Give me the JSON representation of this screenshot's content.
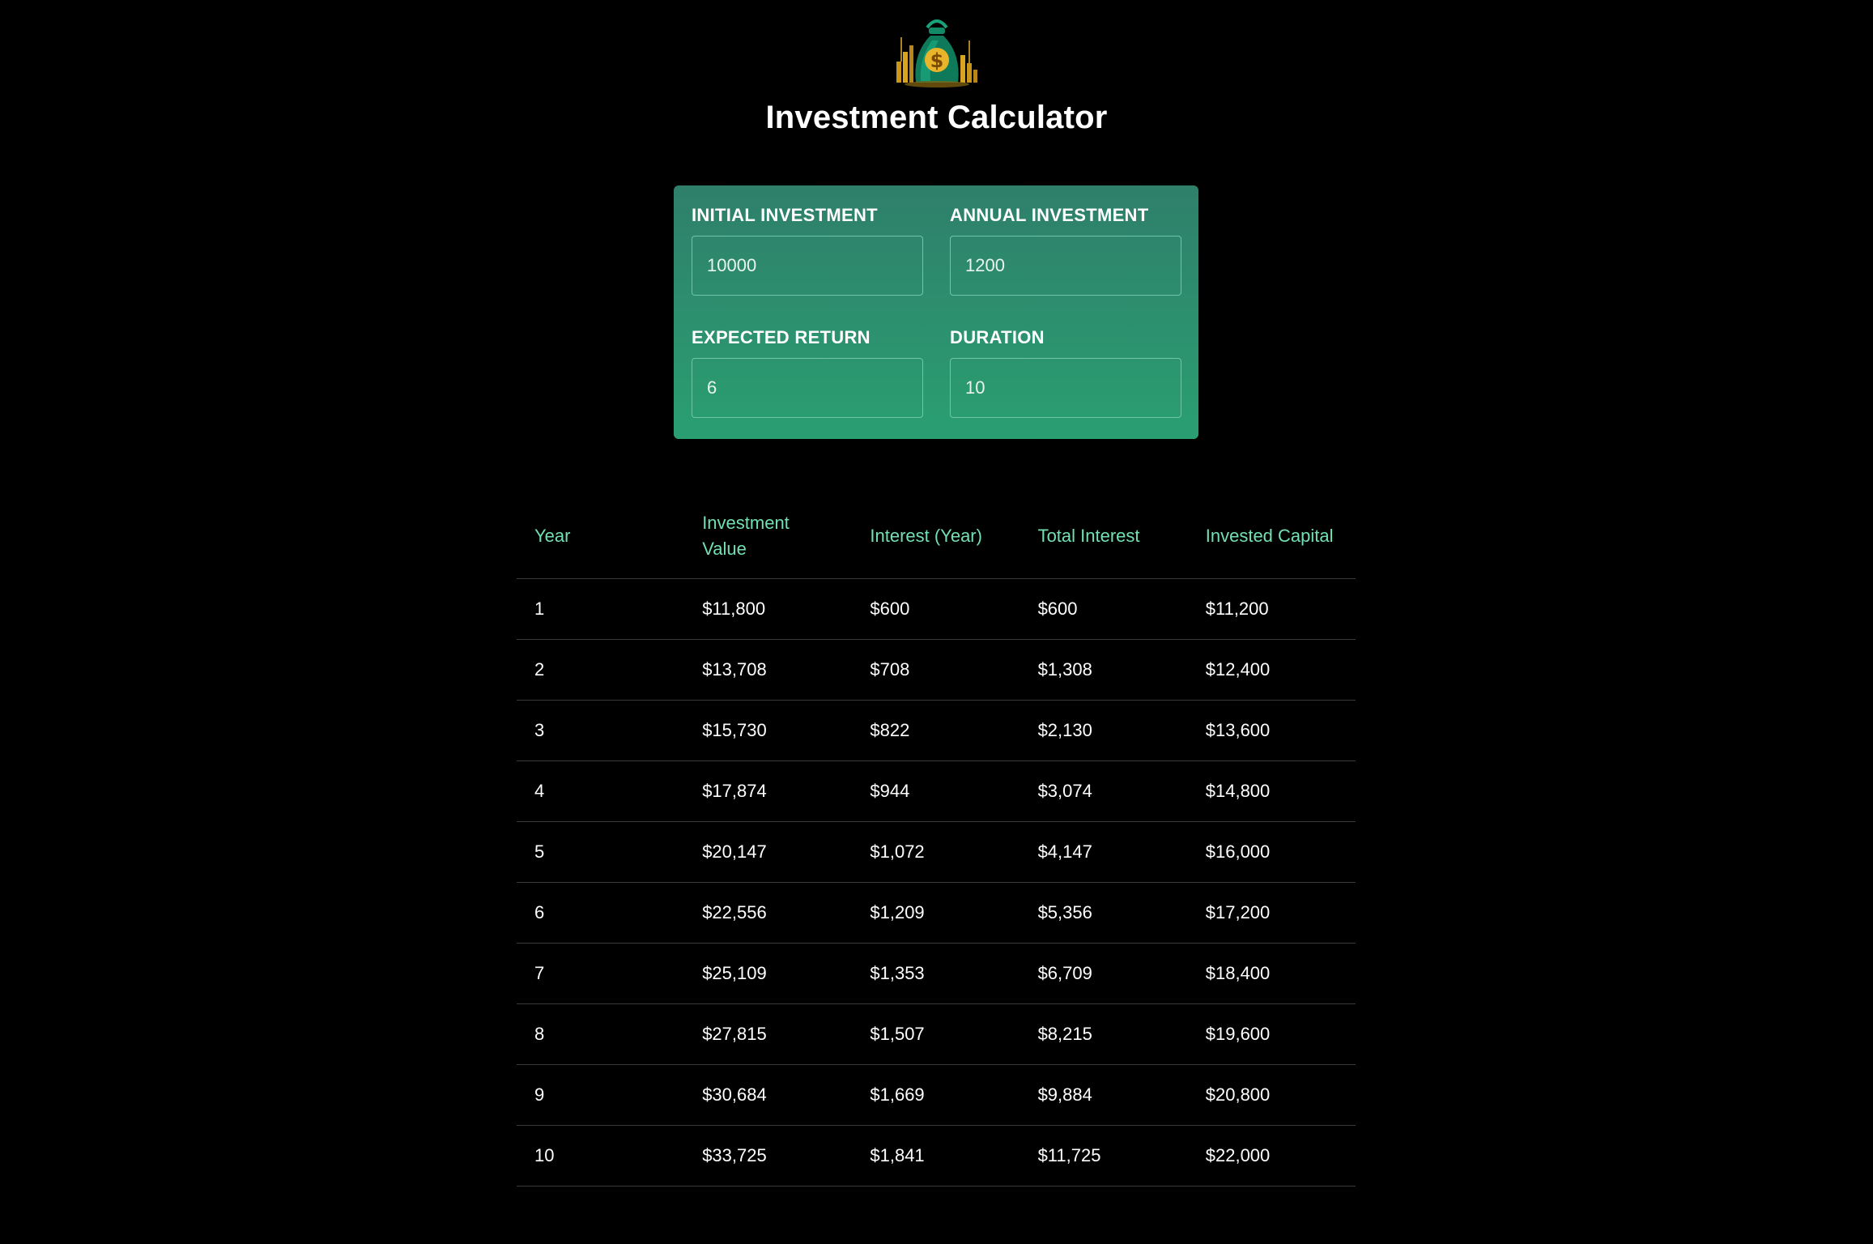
{
  "header": {
    "logo_icon": "money-bag-icon",
    "title": "Investment Calculator"
  },
  "inputs": {
    "initial_investment": {
      "label": "Initial Investment",
      "value": "10000"
    },
    "annual_investment": {
      "label": "Annual Investment",
      "value": "1200"
    },
    "expected_return": {
      "label": "Expected Return",
      "value": "6"
    },
    "duration": {
      "label": "Duration",
      "value": "10"
    }
  },
  "colors": {
    "background": "#000000",
    "panel_top": "#2f7f6a",
    "panel_bottom": "#2a9f72",
    "table_header_text": "#72e0b3"
  },
  "table": {
    "headers": [
      "Year",
      "Investment Value",
      "Interest (Year)",
      "Total Interest",
      "Invested Capital"
    ],
    "rows": [
      [
        "1",
        "$11,800",
        "$600",
        "$600",
        "$11,200"
      ],
      [
        "2",
        "$13,708",
        "$708",
        "$1,308",
        "$12,400"
      ],
      [
        "3",
        "$15,730",
        "$822",
        "$2,130",
        "$13,600"
      ],
      [
        "4",
        "$17,874",
        "$944",
        "$3,074",
        "$14,800"
      ],
      [
        "5",
        "$20,147",
        "$1,072",
        "$4,147",
        "$16,000"
      ],
      [
        "6",
        "$22,556",
        "$1,209",
        "$5,356",
        "$17,200"
      ],
      [
        "7",
        "$25,109",
        "$1,353",
        "$6,709",
        "$18,400"
      ],
      [
        "8",
        "$27,815",
        "$1,507",
        "$8,215",
        "$19,600"
      ],
      [
        "9",
        "$30,684",
        "$1,669",
        "$9,884",
        "$20,800"
      ],
      [
        "10",
        "$33,725",
        "$1,841",
        "$11,725",
        "$22,000"
      ]
    ]
  }
}
